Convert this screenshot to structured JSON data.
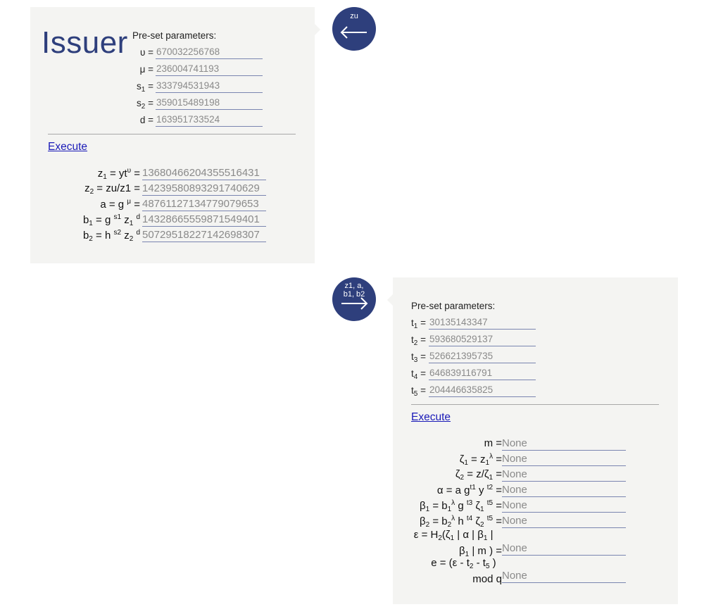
{
  "issuer": {
    "title": "Issuer",
    "preset_label": "Pre-set parameters:",
    "params": [
      {
        "label": "υ =",
        "value": "670032256768"
      },
      {
        "label": "μ =",
        "value": "236004741193"
      },
      {
        "label": "s1 =",
        "value": "333794531943"
      },
      {
        "label": "s2 =",
        "value": "359015489198"
      },
      {
        "label": "d =",
        "value": "163951733524"
      }
    ],
    "execute_label": "Execute",
    "outputs": [
      {
        "label": "z1 = ytυ =",
        "value": "13680466204355516431"
      },
      {
        "label": "z2 = zu/z1 =",
        "value": "14239580893291740629"
      },
      {
        "label": "a = g μ =",
        "value": "48761127134779079653"
      },
      {
        "label": "b1 = g s1 z1 d",
        "value": "14328665559871549401"
      },
      {
        "label": "b2 = h s2 z2 d",
        "value": "50729518227142698307"
      }
    ]
  },
  "arrow_to_issuer": {
    "label": "zu"
  },
  "arrow_to_user": {
    "label_line1": "z1, a,",
    "label_line2": "b1, b2"
  },
  "user": {
    "preset_label": "Pre-set parameters:",
    "params": [
      {
        "label": "t1 =",
        "value": "30135143347"
      },
      {
        "label": "t2 =",
        "value": "593680529137"
      },
      {
        "label": "t3 =",
        "value": "526621395735"
      },
      {
        "label": "t4 =",
        "value": "646839116791"
      },
      {
        "label": "t5 =",
        "value": "204446635825"
      }
    ],
    "execute_label": "Execute",
    "outputs": [
      {
        "label": "m =",
        "value": "None"
      },
      {
        "label": "ζ1 = z1λ =",
        "value": "None"
      },
      {
        "label": "ζ2 = z/ζ1 =",
        "value": "None"
      },
      {
        "label": "α = a gt1 y t2 =",
        "value": "None"
      },
      {
        "label": "β1 = b1λ g t3 ζ1 t5 =",
        "value": "None"
      },
      {
        "label": "β2 = b2λ h t4 ζ2 t5 =",
        "value": "None"
      },
      {
        "label": "ε = H2(ζ1 | α | β1 | β1 | m ) =",
        "value": "None"
      },
      {
        "label": "e = (ε - t2 - t5 ) mod q",
        "value": "None"
      }
    ]
  },
  "colors": {
    "accent": "#2e3f7c",
    "panel": "#f4f4f2",
    "link": "#1a1ab8"
  },
  "icons": [
    "arrow-left-icon",
    "arrow-right-icon"
  ]
}
